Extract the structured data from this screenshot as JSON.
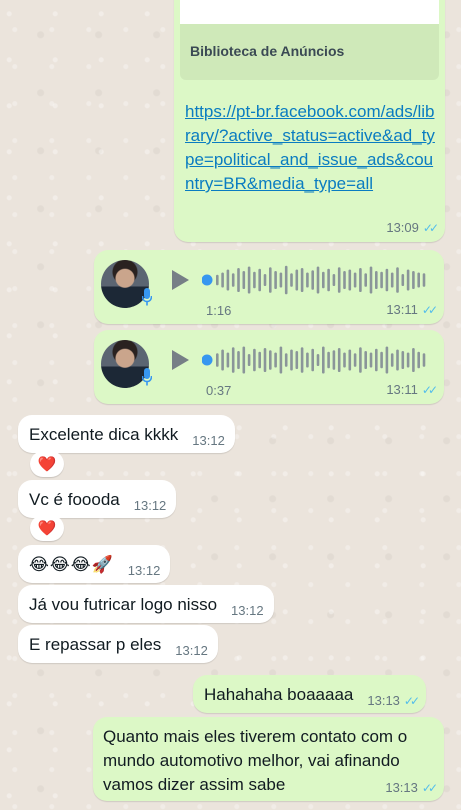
{
  "link_message": {
    "preview_title": "Biblioteca de Anúncios",
    "url": "https://pt-br.facebook.com/ads/library/?active_status=active&ad_type=political_and_issue_ads&country=BR&media_type=all",
    "time": "13:09",
    "read_ticks": "✓✓"
  },
  "voice_messages": [
    {
      "duration": "1:16",
      "time": "13:11",
      "read_ticks": "✓✓",
      "waveform": [
        0.35,
        0.5,
        0.7,
        0.45,
        0.8,
        0.6,
        0.9,
        0.55,
        0.75,
        0.4,
        0.85,
        0.6,
        0.5,
        0.95,
        0.45,
        0.7,
        0.8,
        0.5,
        0.65,
        0.9,
        0.55,
        0.75,
        0.4,
        0.85,
        0.6,
        0.7,
        0.5,
        0.8,
        0.45,
        0.9,
        0.6,
        0.55,
        0.75,
        0.5,
        0.85,
        0.4,
        0.7,
        0.6,
        0.5,
        0.45
      ]
    },
    {
      "duration": "0:37",
      "time": "13:11",
      "read_ticks": "✓✓",
      "waveform": [
        0.45,
        0.7,
        0.5,
        0.85,
        0.6,
        0.9,
        0.4,
        0.75,
        0.55,
        0.8,
        0.65,
        0.5,
        0.9,
        0.45,
        0.7,
        0.6,
        0.85,
        0.5,
        0.75,
        0.4,
        0.9,
        0.55,
        0.65,
        0.8,
        0.5,
        0.7,
        0.45,
        0.85,
        0.6,
        0.5,
        0.75,
        0.55,
        0.9,
        0.45,
        0.7,
        0.6,
        0.5,
        0.8,
        0.55,
        0.45
      ]
    }
  ],
  "incoming": [
    {
      "text": "Excelente dica kkkk",
      "time": "13:12"
    },
    {
      "text": "Vc é foooda",
      "time": "13:12"
    },
    {
      "text": "😂😂😂🚀",
      "time": "13:12"
    },
    {
      "text": "Já vou futricar logo nisso",
      "time": "13:12"
    },
    {
      "text": "E repassar p eles",
      "time": "13:12"
    }
  ],
  "reactions": [
    "❤️",
    "❤️"
  ],
  "outgoing": [
    {
      "text": "Hahahaha boaaaaa",
      "time": "13:13",
      "read_ticks": "✓✓"
    },
    {
      "text": "Quanto mais eles tiverem contato com o mundo automotivo melhor, vai afinando vamos dizer assim sabe",
      "time": "13:13",
      "read_ticks": "✓✓"
    }
  ],
  "colors": {
    "outgoing_bubble": "#dcf8c6",
    "incoming_bubble": "#ffffff",
    "read_ticks": "#53bdeb",
    "link": "#0a7cc1",
    "wave_played_dot": "#3797f0"
  }
}
